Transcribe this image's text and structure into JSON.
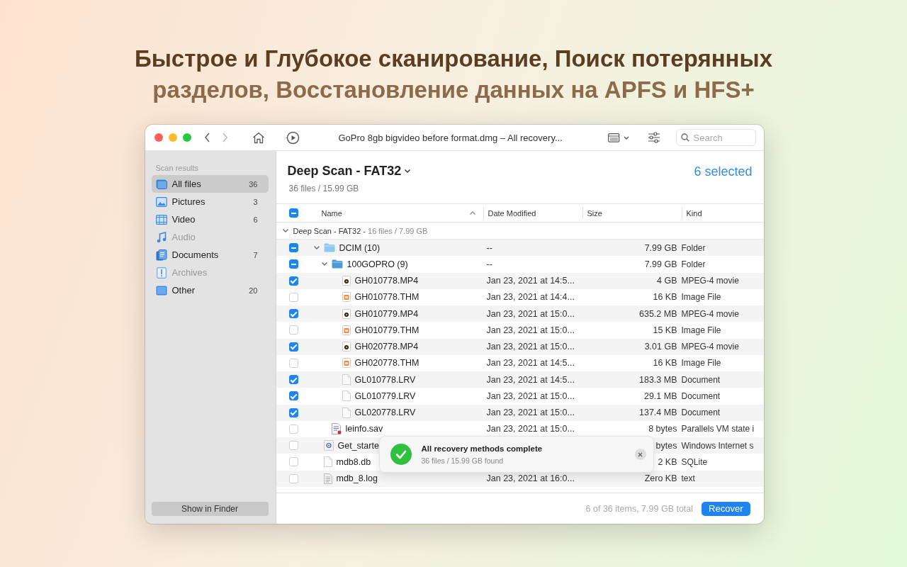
{
  "headline": [
    "Быстрое и Глубокое сканирование, Поиск потерянных",
    "разделов, Восстановление данных на APFS и HFS+"
  ],
  "window": {
    "title": "GoPro 8gb bigvideo before format.dmg – All recovery...",
    "search": {
      "placeholder": "Search"
    }
  },
  "sidebar": {
    "section": "Scan results",
    "items": [
      {
        "kind": "all",
        "label": "All files",
        "count": "36",
        "selected": true,
        "disabled": false
      },
      {
        "kind": "pictures",
        "label": "Pictures",
        "count": "3",
        "selected": false,
        "disabled": false
      },
      {
        "kind": "video",
        "label": "Video",
        "count": "6",
        "selected": false,
        "disabled": false
      },
      {
        "kind": "audio",
        "label": "Audio",
        "selected": false,
        "disabled": true
      },
      {
        "kind": "documents",
        "label": "Documents",
        "count": "7",
        "selected": false,
        "disabled": false
      },
      {
        "kind": "archives",
        "label": "Archives",
        "selected": false,
        "disabled": true
      },
      {
        "kind": "other",
        "label": "Other",
        "count": "20",
        "selected": false,
        "disabled": false
      }
    ],
    "button": "Show in Finder"
  },
  "header": {
    "title": "Deep Scan - FAT32",
    "summary": "36 files / 15.99 GB",
    "selection": "6 selected"
  },
  "table": {
    "select_all": {
      "checked": true,
      "partial": true
    },
    "columns": [
      "Name",
      "Date Modified",
      "Size",
      "Kind"
    ],
    "group": {
      "title": "Deep Scan - FAT32 -",
      "summary": "16 files / 7.99 GB",
      "expanded": true
    },
    "rows": [
      {
        "kind": "folder",
        "name": "DCIM (10)",
        "date": "--",
        "size": "7.99 GB",
        "type": "Folder",
        "checked": true,
        "partial": true,
        "expanded": true,
        "children": [
          {
            "kind": "folder",
            "name": "100GOPRO (9)",
            "date": "--",
            "size": "7.99 GB",
            "type": "Folder",
            "checked": true,
            "partial": true,
            "expanded": true,
            "children": [
              {
                "kind": "movie",
                "name": "GH010778.MP4",
                "date": "Jan 23, 2021 at 14:5...",
                "size": "4 GB",
                "type": "MPEG-4 movie",
                "checked": true
              },
              {
                "kind": "image",
                "name": "GH010778.THM",
                "date": "Jan 23, 2021 at 14:4...",
                "size": "16 KB",
                "type": "Image File",
                "checked": false
              },
              {
                "kind": "movie",
                "name": "GH010779.MP4",
                "date": "Jan 23, 2021 at 15:0...",
                "size": "635.2 MB",
                "type": "MPEG-4 movie",
                "checked": true
              },
              {
                "kind": "image",
                "name": "GH010779.THM",
                "date": "Jan 23, 2021 at 15:0...",
                "size": "15 KB",
                "type": "Image File",
                "checked": false
              },
              {
                "kind": "movie",
                "name": "GH020778.MP4",
                "date": "Jan 23, 2021 at 15:0...",
                "size": "3.01 GB",
                "type": "MPEG-4 movie",
                "checked": true
              },
              {
                "kind": "image",
                "name": "GH020778.THM",
                "date": "Jan 23, 2021 at 14:5...",
                "size": "16 KB",
                "type": "Image File",
                "checked": false
              },
              {
                "kind": "document",
                "name": "GL010778.LRV",
                "date": "Jan 23, 2021 at 14:5...",
                "size": "183.3 MB",
                "type": "Document",
                "checked": true
              },
              {
                "kind": "document",
                "name": "GL010779.LRV",
                "date": "Jan 23, 2021 at 15:0...",
                "size": "29.1 MB",
                "type": "Document",
                "checked": true
              },
              {
                "kind": "document",
                "name": "GL020778.LRV",
                "date": "Jan 23, 2021 at 15:0...",
                "size": "137.4 MB",
                "type": "Document",
                "checked": true
              }
            ]
          },
          {
            "kind": "vm",
            "name": "leinfo.sav",
            "date": "Jan 23, 2021 at 15:0...",
            "size": "8 bytes",
            "type": "Parallels VM state i",
            "checked": false
          }
        ]
      },
      {
        "kind": "web",
        "name": "Get_starte",
        "size": "bytes",
        "type": "Windows Internet s",
        "checked": false
      },
      {
        "kind": "document",
        "name": "mdb8.db",
        "size": "2 KB",
        "type": "SQLite",
        "checked": false
      },
      {
        "kind": "text",
        "name": "mdb_8.log",
        "date": "Jan 23, 2021 at 16:0...",
        "size": "Zero KB",
        "type": "text",
        "checked": false
      }
    ]
  },
  "footer": {
    "status": "6 of 36 items, 7.99 GB total",
    "button": "Recover"
  },
  "toast": {
    "title": "All recovery methods complete",
    "subtitle": "36 files / 15.99 GB found"
  }
}
